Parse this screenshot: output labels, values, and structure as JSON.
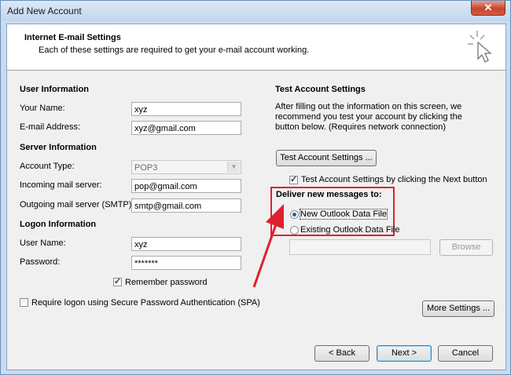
{
  "window": {
    "title": "Add New Account",
    "close_label": "✕"
  },
  "header": {
    "title": "Internet E-mail Settings",
    "subtitle": "Each of these settings are required to get your e-mail account working."
  },
  "user_info": {
    "heading": "User Information",
    "name_label": "Your Name:",
    "name_value": "xyz",
    "email_label": "E-mail Address:",
    "email_value": "xyz@gmail.com"
  },
  "server_info": {
    "heading": "Server Information",
    "account_type_label": "Account Type:",
    "account_type_value": "POP3",
    "incoming_label": "Incoming mail server:",
    "incoming_value": "pop@gmail.com",
    "outgoing_label": "Outgoing mail server (SMTP):",
    "outgoing_value": "smtp@gmail.com"
  },
  "logon_info": {
    "heading": "Logon Information",
    "username_label": "User Name:",
    "username_value": "xyz",
    "password_label": "Password:",
    "password_value": "*******",
    "remember_label": "Remember password",
    "remember_checked": true,
    "spa_label": "Require logon using Secure Password Authentication (SPA)",
    "spa_checked": false
  },
  "test_settings": {
    "heading": "Test Account Settings",
    "description": "After filling out the information on this screen, we recommend you test your account by clicking the button below. (Requires network connection)",
    "test_button": "Test Account Settings ...",
    "test_next_label": "Test Account Settings by clicking the Next button",
    "test_next_checked": true
  },
  "deliver": {
    "heading": "Deliver new messages to:",
    "new_file_label": "New Outlook Data File",
    "existing_file_label": "Existing Outlook Data File",
    "selected": "New Outlook Data File",
    "browse_button": "Browse",
    "path_value": ""
  },
  "buttons": {
    "more_settings": "More Settings ...",
    "back": "< Back",
    "next": "Next >",
    "cancel": "Cancel"
  },
  "colors": {
    "highlight_box": "#e0202e",
    "arrow": "#e0202e"
  }
}
